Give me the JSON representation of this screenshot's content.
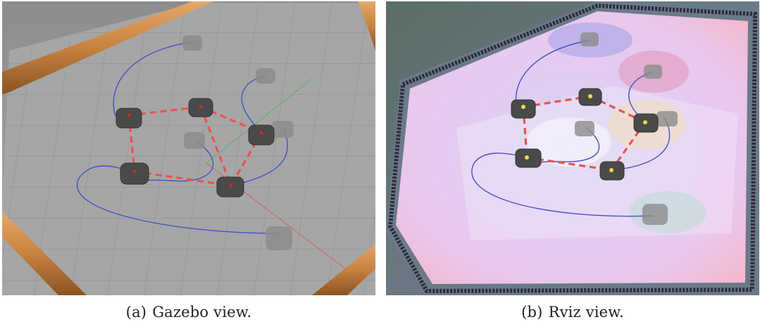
{
  "captions": [
    {
      "label": "(a)",
      "text": "Gazebo view."
    },
    {
      "label": "(b)",
      "text": "Rviz view."
    }
  ],
  "colors": {
    "trajectory": "#4452c8",
    "formation_link": "#e8534f",
    "robot": "#4a4a4a",
    "ghost_robot": "#8c8c8c",
    "gazebo_floor": "#a5a5a5",
    "gazebo_wall": "#c8813f",
    "rviz_floor": "#e6cdf0",
    "rviz_border": "#6b7a88"
  },
  "icons": [
    "robot-icon",
    "ghost-robot-icon"
  ]
}
